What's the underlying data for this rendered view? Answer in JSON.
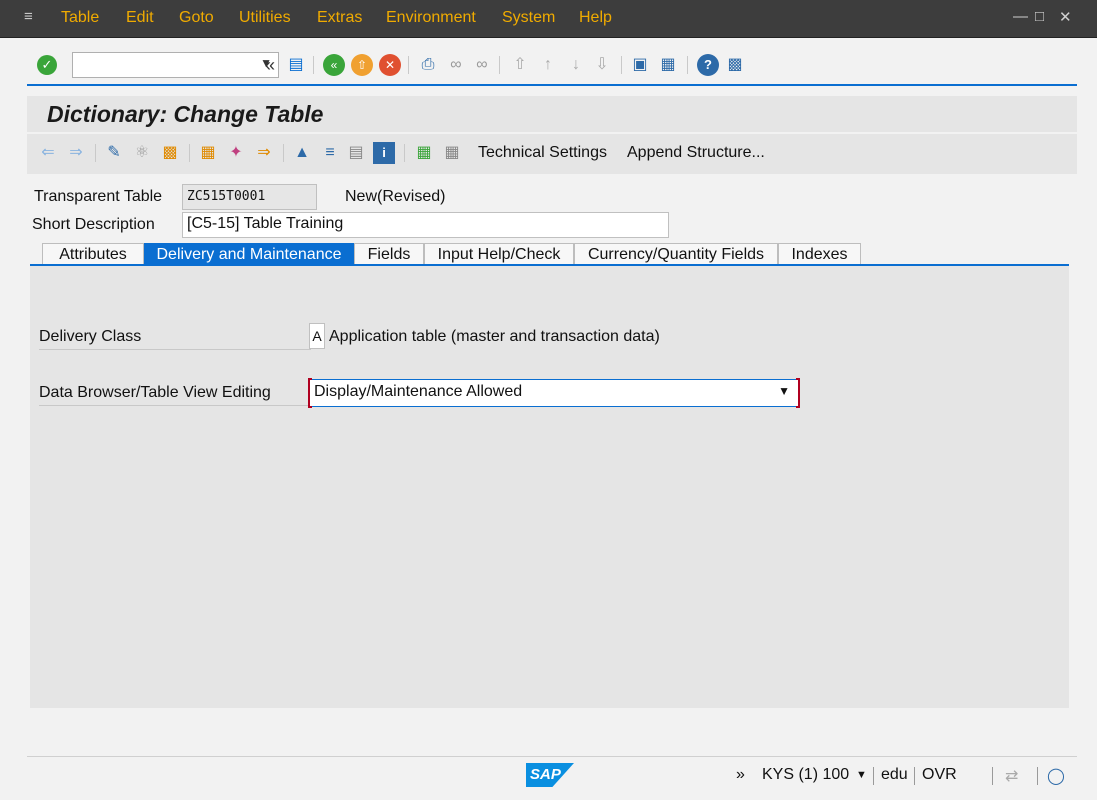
{
  "menu": {
    "items": [
      "Table",
      "Edit",
      "Goto",
      "Utilities",
      "Extras",
      "Environment",
      "System",
      "Help"
    ]
  },
  "toolbar": {
    "command_field_value": "",
    "icons": [
      "enter-icon",
      "back-arrows-icon",
      "save-icon",
      "back-icon",
      "exit-icon",
      "cancel-icon",
      "print-icon",
      "find-icon",
      "find-next-icon",
      "first-page-icon",
      "previous-page-icon",
      "next-page-icon",
      "last-page-icon",
      "create-session-icon",
      "shortcut-icon",
      "help-icon",
      "customize-layout-icon"
    ]
  },
  "title": "Dictionary: Change Table",
  "app_toolbar": {
    "technical_settings": "Technical Settings",
    "append_structure": "Append Structure..."
  },
  "header": {
    "transparent_table_label": "Transparent Table",
    "transparent_table_value": "ZC515T0001",
    "status": "New(Revised)",
    "short_description_label": "Short Description",
    "short_description_value": "[C5-15] Table Training"
  },
  "tabs": [
    "Attributes",
    "Delivery and Maintenance",
    "Fields",
    "Input Help/Check",
    "Currency/Quantity Fields",
    "Indexes"
  ],
  "active_tab": "Delivery and Maintenance",
  "delivery": {
    "delivery_class_label": "Delivery Class",
    "delivery_class_value": "A",
    "delivery_class_text": "Application table (master and transaction data)",
    "browser_label": "Data Browser/Table View Editing",
    "browser_value": "Display/Maintenance Allowed"
  },
  "status_bar": {
    "system": "KYS (1) 100",
    "user": "edu",
    "mode": "OVR",
    "more": "»",
    "logo": "SAP"
  },
  "colors": {
    "menu_bg": "#3d3d3d",
    "menu_text": "#f0ab00",
    "accent": "#0a6ed1",
    "panel_bg": "#e5e5e5"
  }
}
